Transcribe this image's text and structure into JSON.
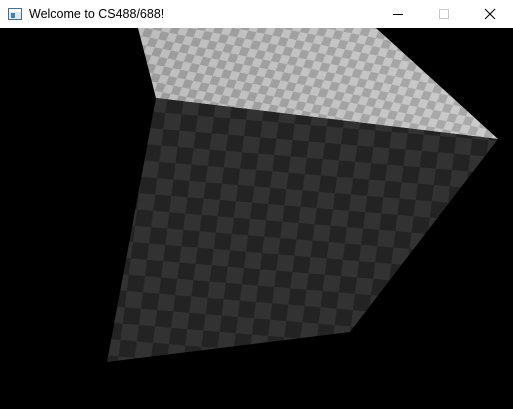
{
  "window": {
    "title": "Welcome to CS488/688!",
    "icons": {
      "app": "app-window-icon",
      "minimize": "minimize-icon",
      "maximize": "maximize-icon",
      "close": "close-icon"
    }
  },
  "scene": {
    "background_color": "#000000",
    "top_face": {
      "light": "#c8c8c8",
      "dark": "#a4a4a4"
    },
    "front_face": {
      "light": "#323232",
      "dark": "#222222"
    }
  }
}
